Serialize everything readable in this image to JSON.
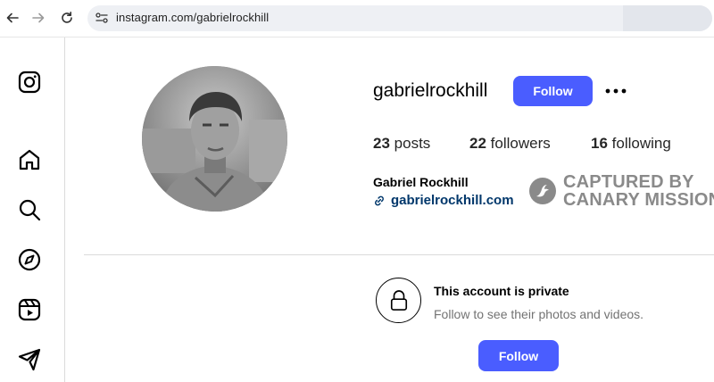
{
  "browser": {
    "url": "instagram.com/gabrielrockhill"
  },
  "profile": {
    "username": "gabrielrockhill",
    "follow_label": "Follow",
    "posts_count": "23",
    "posts_label": "posts",
    "followers_count": "22",
    "followers_label": "followers",
    "following_count": "16",
    "following_label": "following",
    "full_name": "Gabriel Rockhill",
    "website": "gabrielrockhill.com"
  },
  "watermark": {
    "line1": "CAPTURED BY",
    "line2": "CANARY MISSION"
  },
  "private_notice": {
    "title": "This account is private",
    "subtitle": "Follow to see their photos and videos.",
    "follow_label": "Follow"
  },
  "sidebar": {
    "items": [
      "instagram-logo",
      "home",
      "search",
      "explore",
      "reels",
      "messages"
    ]
  },
  "colors": {
    "accent": "#4a5dff",
    "link": "#00376b",
    "muted_text": "#737373",
    "watermark": "#8a8a8a"
  }
}
